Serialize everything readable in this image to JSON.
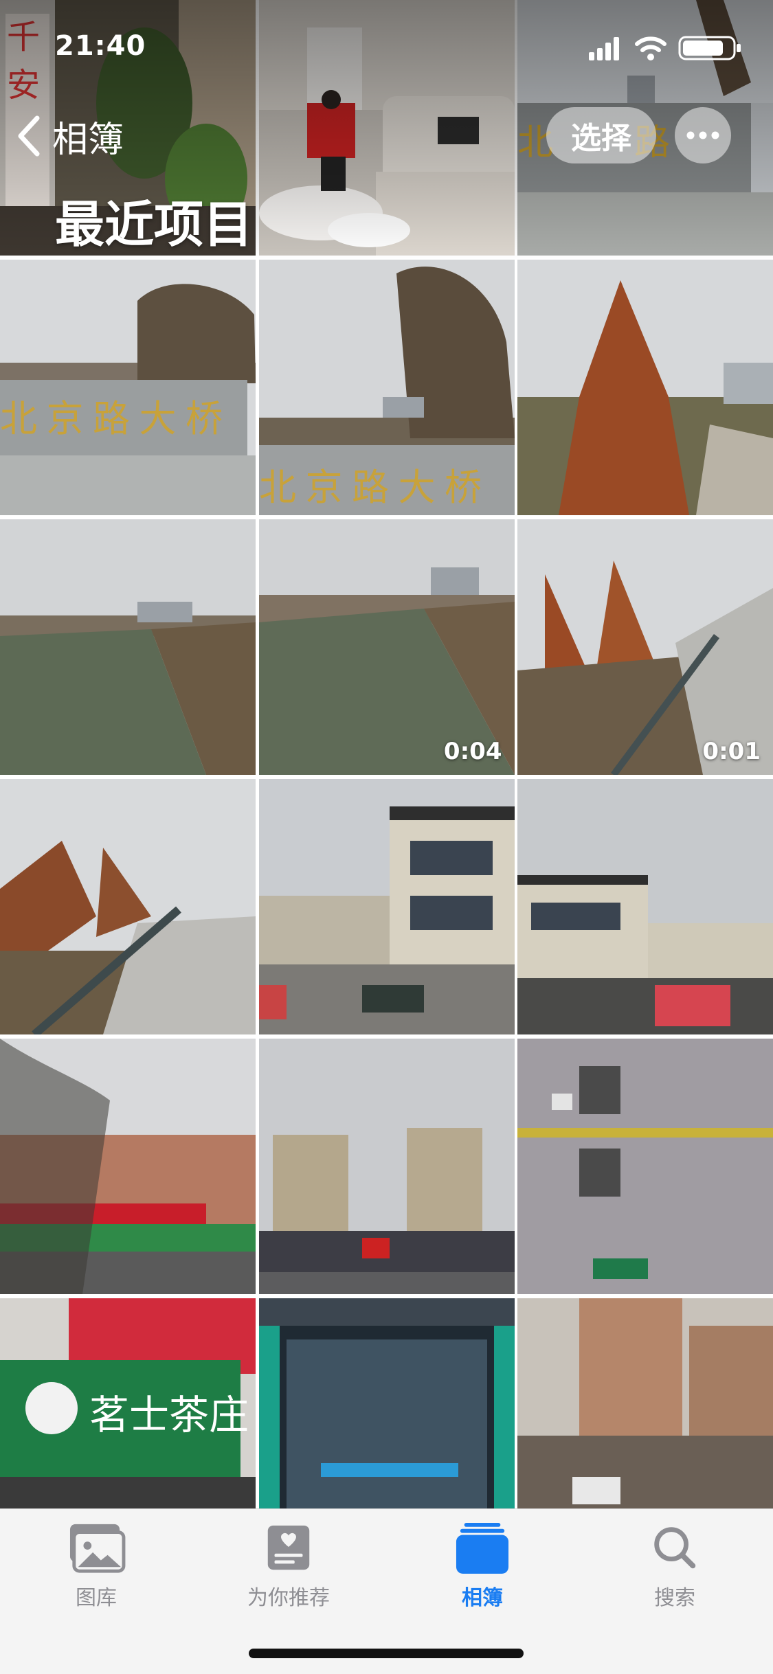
{
  "status_bar": {
    "time": "21:40"
  },
  "nav": {
    "back_label": "相簿",
    "title": "最近项目",
    "select_label": "选择"
  },
  "photos": [
    {
      "subject": "living-room",
      "duration": ""
    },
    {
      "subject": "living-room-person",
      "duration": ""
    },
    {
      "subject": "bridge-stone",
      "duration": ""
    },
    {
      "subject": "bridge-sign",
      "duration": ""
    },
    {
      "subject": "bridge-sign-tree",
      "duration": ""
    },
    {
      "subject": "red-tree",
      "duration": ""
    },
    {
      "subject": "river",
      "duration": ""
    },
    {
      "subject": "river-video",
      "duration": "0:04"
    },
    {
      "subject": "walkway-trees",
      "duration": "0:01"
    },
    {
      "subject": "walkway-railing",
      "duration": ""
    },
    {
      "subject": "residential-building",
      "duration": ""
    },
    {
      "subject": "residential-building-sign",
      "duration": ""
    },
    {
      "subject": "street-shops",
      "duration": ""
    },
    {
      "subject": "twin-towers",
      "duration": ""
    },
    {
      "subject": "wall-windows",
      "duration": ""
    },
    {
      "subject": "tea-shop",
      "duration": ""
    },
    {
      "subject": "glass-storefront",
      "duration": ""
    },
    {
      "subject": "apartment-reflection",
      "duration": ""
    }
  ],
  "tabs": [
    {
      "label": "图库",
      "icon": "photo-library-icon",
      "active": false
    },
    {
      "label": "为你推荐",
      "icon": "for-you-icon",
      "active": false
    },
    {
      "label": "相簿",
      "icon": "albums-icon",
      "active": true
    },
    {
      "label": "搜索",
      "icon": "search-icon",
      "active": false
    }
  ],
  "colors": {
    "accent": "#1a7df2",
    "tab_inactive": "#8e8e93"
  }
}
